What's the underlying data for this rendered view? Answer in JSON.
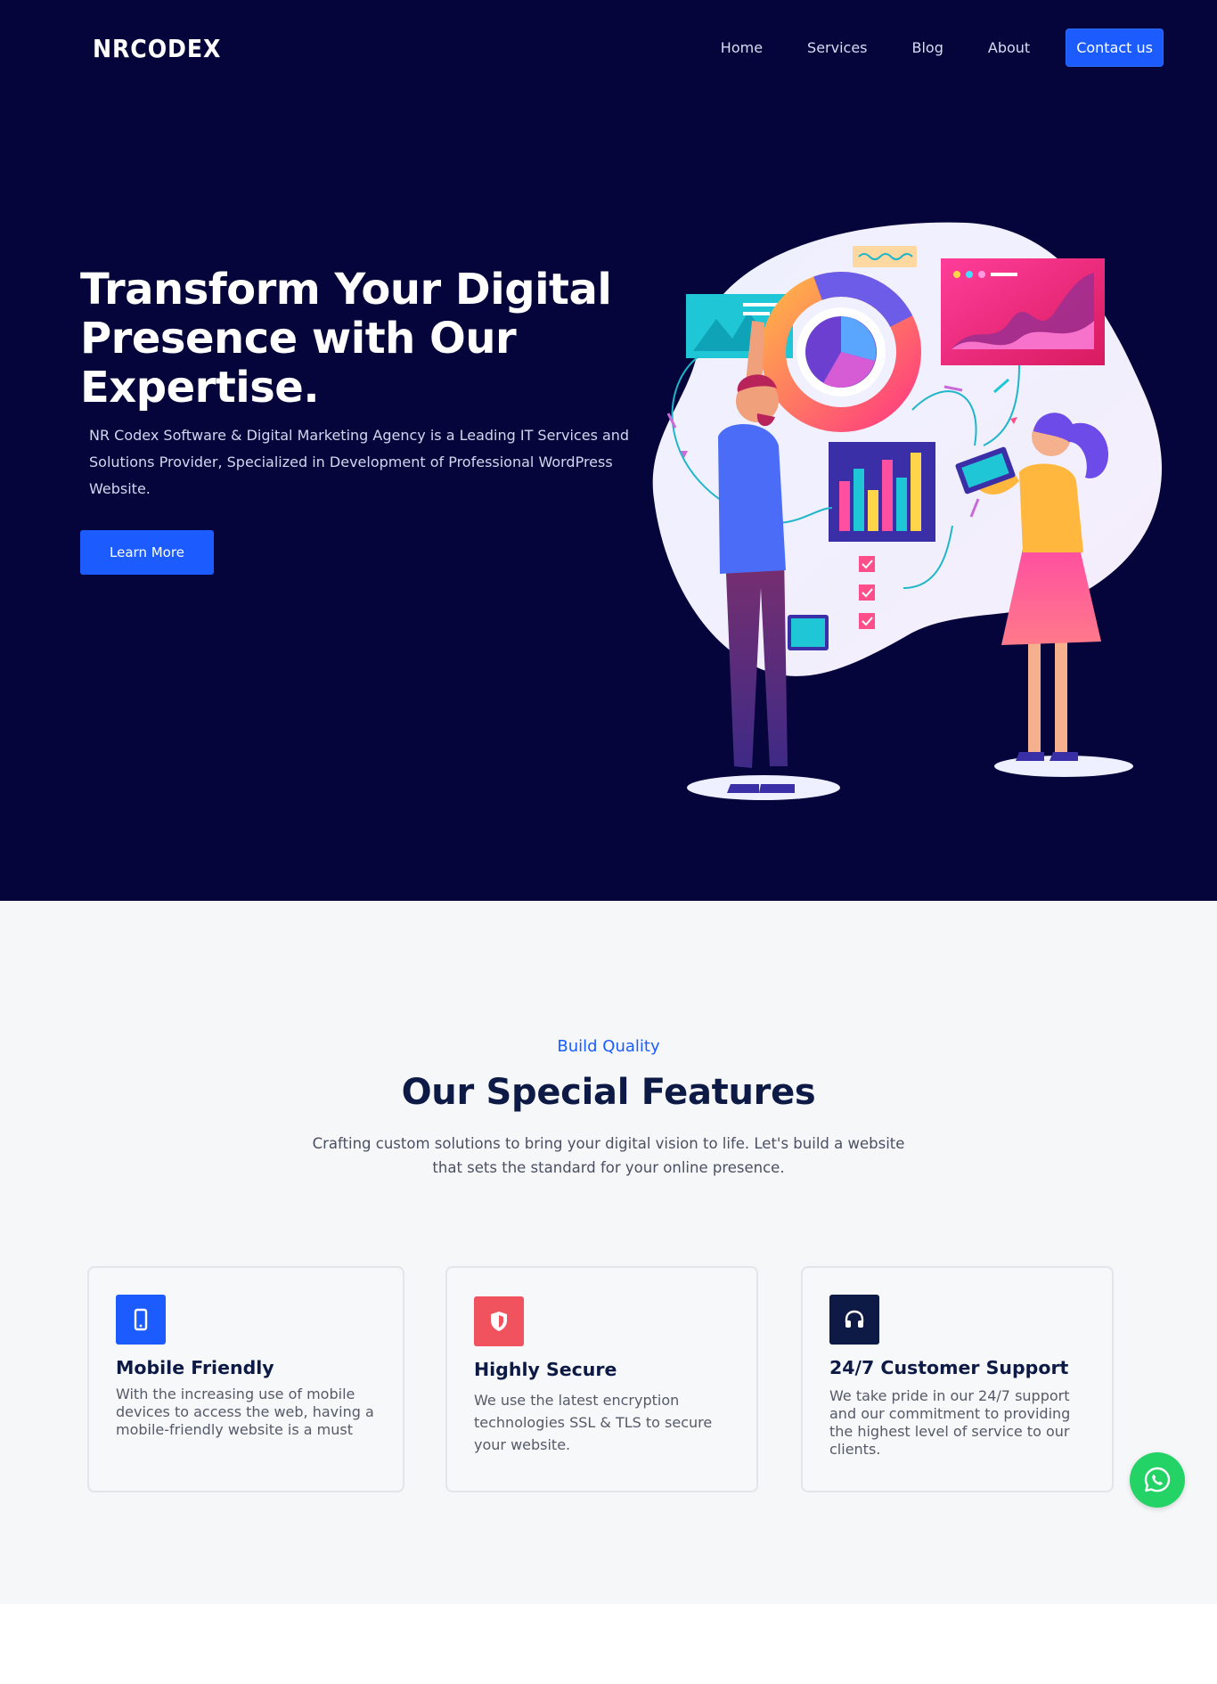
{
  "header": {
    "logo": "NRCODEX",
    "nav": [
      {
        "label": "Home"
      },
      {
        "label": "Services"
      },
      {
        "label": "Blog"
      },
      {
        "label": "About"
      }
    ],
    "contact_label": "Contact us"
  },
  "hero": {
    "title": "Transform Your Digital Presence with Our Expertise.",
    "description": "NR Codex Software & Digital Marketing Agency is a Leading IT Services and Solutions Provider, Specialized in Development of Professional WordPress Website.",
    "cta_label": "Learn More"
  },
  "features": {
    "eyebrow": "Build Quality",
    "title": "Our Special Features",
    "description": "Crafting custom solutions to bring your digital vision to life. Let's build a website that sets the standard for your online presence.",
    "cards": [
      {
        "icon": "mobile-icon",
        "title": "Mobile Friendly",
        "text": "With the increasing use of mobile devices to access the web, having a mobile-friendly website is a must",
        "icon_bg": "#1c5cff"
      },
      {
        "icon": "shield-icon",
        "title": "Highly Secure",
        "text": "We use the latest encryption technologies SSL & TLS to secure your website.",
        "icon_bg": "#f0525e"
      },
      {
        "icon": "headset-icon",
        "title": "24/7 Customer Support",
        "text": "We take pride in our 24/7 support and our commitment to providing the highest level of service to our clients.",
        "icon_bg": "#0c1a45"
      }
    ]
  },
  "colors": {
    "hero_bg": "#06053b",
    "accent": "#1c5cff",
    "section_bg": "#f6f7f9",
    "whatsapp": "#24d366"
  }
}
